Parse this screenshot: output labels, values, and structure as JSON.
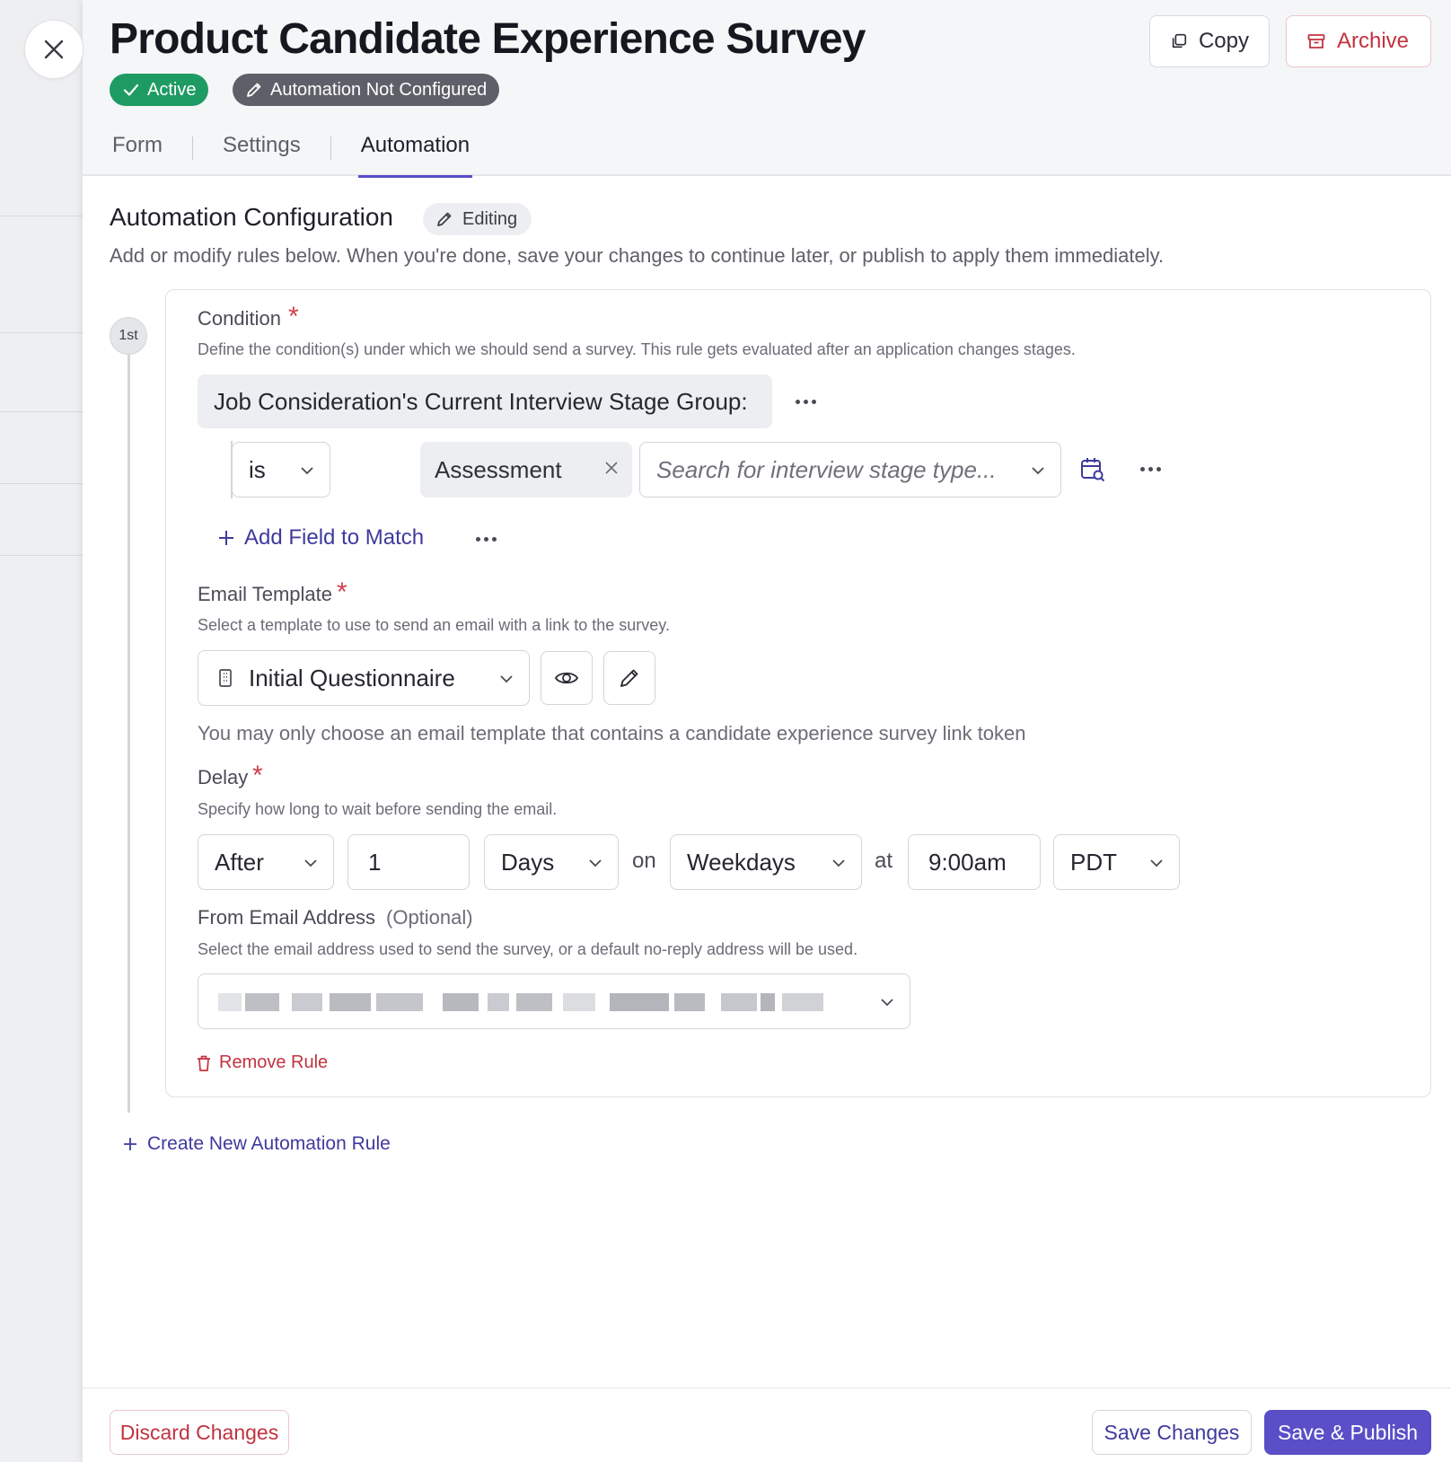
{
  "page": {
    "title": "Product Candidate Experience Survey",
    "close_icon": "close-icon",
    "status_badge": "Active",
    "automation_badge": "Automation Not Configured"
  },
  "header_actions": {
    "copy_label": "Copy",
    "archive_label": "Archive"
  },
  "tabs": [
    {
      "label": "Form",
      "active": false
    },
    {
      "label": "Settings",
      "active": false
    },
    {
      "label": "Automation",
      "active": true
    }
  ],
  "automation": {
    "title": "Automation Configuration",
    "editing_badge": "Editing",
    "description": "Add or modify rules below. When you're done, save your changes to continue later, or publish to apply them immediately."
  },
  "rule": {
    "step_label": "1st",
    "condition": {
      "label": "Condition",
      "required_mark": "*",
      "description": "Define the condition(s) under which we should send a survey. This rule gets evaluated after an application changes stages.",
      "field": "Job Consideration's Current Interview Stage Group:",
      "operator": "is",
      "value_chip": "Assessment",
      "search_placeholder": "Search for interview stage type...",
      "add_field_label": "Add Field to Match"
    },
    "email_template": {
      "label": "Email Template",
      "required_mark": "*",
      "description": "Select a template to use to send an email with a link to the survey.",
      "selected": "Initial Questionnaire",
      "note": "You may only choose an email template that contains a candidate experience survey link token"
    },
    "delay": {
      "label": "Delay",
      "required_mark": "*",
      "description": "Specify how long to wait before sending the email.",
      "timing": "After",
      "amount": "1",
      "unit": "Days",
      "on_label": "on",
      "days": "Weekdays",
      "at_label": "at",
      "time": "9:00am",
      "timezone": "PDT"
    },
    "from_email": {
      "label": "From Email Address",
      "optional": "(Optional)",
      "description": "Select the email address used to send the survey, or a default no-reply address will be used."
    },
    "remove_label": "Remove Rule"
  },
  "create_rule_label": "Create New Automation Rule",
  "footer": {
    "discard_label": "Discard Changes",
    "save_label": "Save Changes",
    "publish_label": "Save & Publish"
  },
  "colors": {
    "accent": "#5a4fc7",
    "danger": "#c2323f",
    "success": "#1e9b63"
  }
}
